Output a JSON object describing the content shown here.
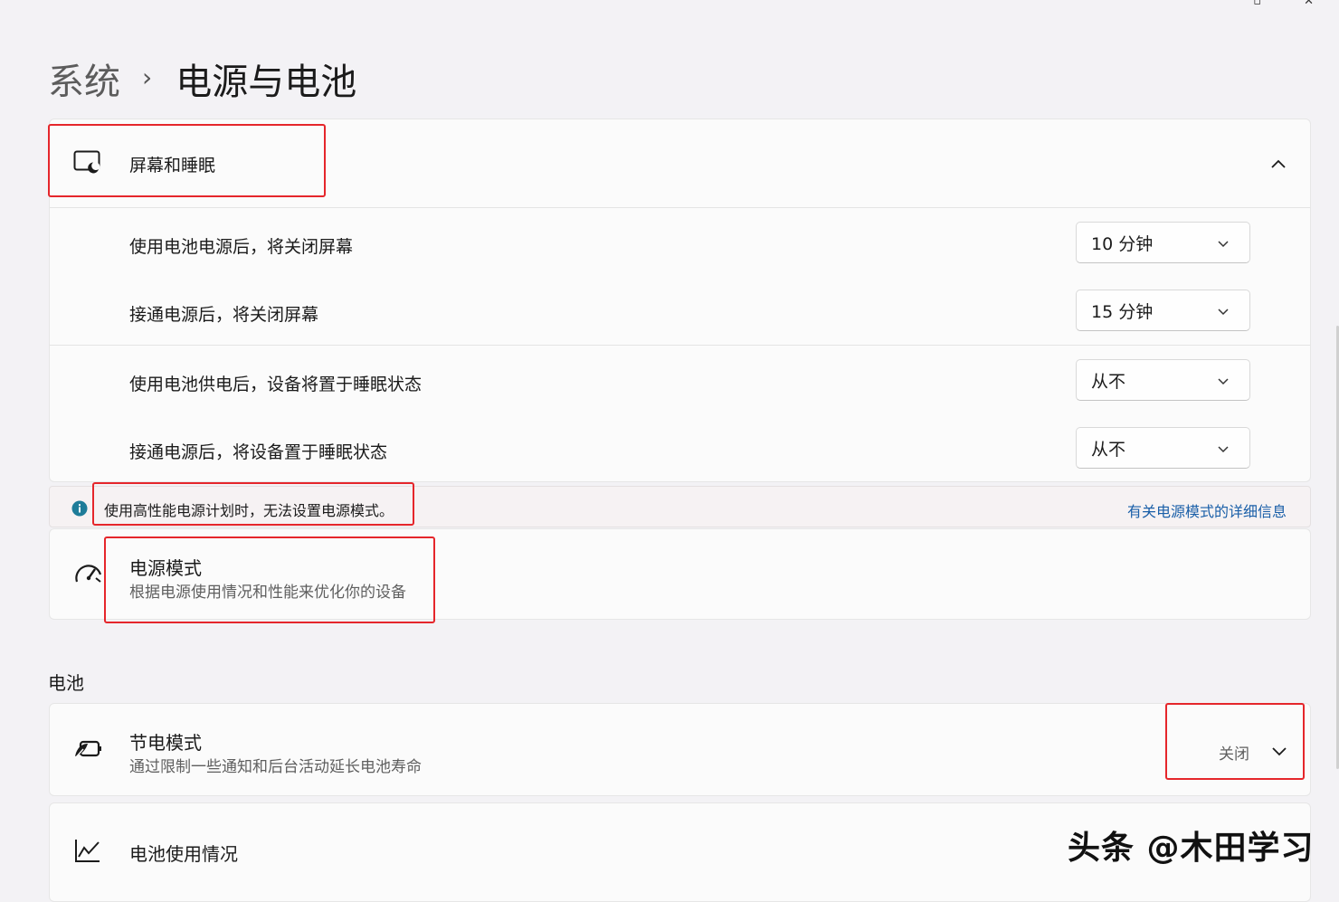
{
  "breadcrumb": {
    "parent": "系统",
    "separator": "›",
    "current": "电源与电池"
  },
  "screen_sleep": {
    "header_label": "屏幕和睡眠",
    "rows": [
      {
        "label": "使用电池电源后，将关闭屏幕",
        "value": "10 分钟"
      },
      {
        "label": "接通电源后，将关闭屏幕",
        "value": "15 分钟"
      },
      {
        "label": "使用电池供电后，设备将置于睡眠状态",
        "value": "从不"
      },
      {
        "label": "接通电源后，将设备置于睡眠状态",
        "value": "从不"
      }
    ]
  },
  "info_bar": {
    "text": "使用高性能电源计划时，无法设置电源模式。",
    "link": "有关电源模式的详细信息",
    "icon_color": "#1e7c99"
  },
  "power_mode": {
    "title": "电源模式",
    "subtitle": "根据电源使用情况和性能来优化你的设备"
  },
  "battery": {
    "section_title": "电池",
    "saver": {
      "title": "节电模式",
      "subtitle": "通过限制一些通知和后台活动延长电池寿命",
      "value": "关闭"
    },
    "usage": {
      "title": "电池使用情况"
    }
  },
  "watermark": "头条 @木田学习",
  "colors": {
    "highlight": "#e5262b",
    "link": "#1a5fa8",
    "background": "#f3f2f5"
  }
}
